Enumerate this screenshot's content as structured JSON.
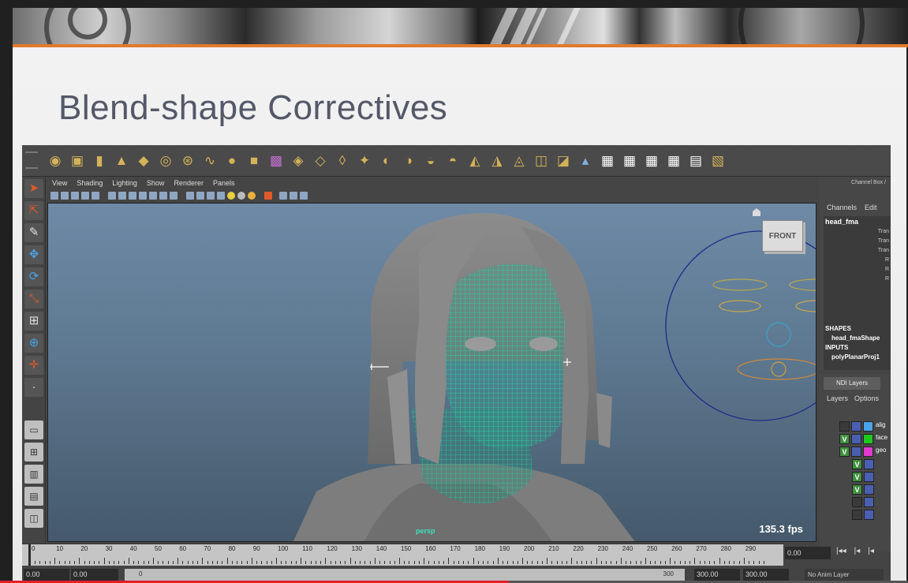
{
  "slide": {
    "title": "Blend-shape Correctives"
  },
  "maya": {
    "panel_menu": [
      "View",
      "Shading",
      "Lighting",
      "Show",
      "Renderer",
      "Panels"
    ],
    "viewcube_label": "FRONT",
    "camera": "persp",
    "fps": "135.3 fps",
    "channel_box": {
      "header": "Channel Box /",
      "menu": [
        "Channels",
        "Edit"
      ],
      "object": "head_fma",
      "attributes": [
        "Tran",
        "Tran",
        "Tran",
        "R",
        "R",
        "R"
      ],
      "shapes_header": "SHAPES",
      "shape_item": "head_fmaShape",
      "inputs_header": "INPUTS",
      "input_item": "polyPlanarProj1"
    },
    "layer_editor": {
      "tab": "NDI Layers",
      "menu": [
        "Layers",
        "Options"
      ],
      "layers": [
        {
          "visible": "",
          "color": "#4aa3e8",
          "name": "alig"
        },
        {
          "visible": "V",
          "color": "#1ec81e",
          "name": "face"
        },
        {
          "visible": "V",
          "color": "#e03ad0",
          "name": "geo"
        },
        {
          "visible": "V",
          "color": "#4a5fb0",
          "name": ""
        },
        {
          "visible": "V",
          "color": "#4a5fb0",
          "name": ""
        },
        {
          "visible": "V",
          "color": "#4a5fb0",
          "name": ""
        },
        {
          "visible": "",
          "color": "#4a5fb0",
          "name": ""
        },
        {
          "visible": "",
          "color": "#1e4fc8",
          "name": ""
        }
      ]
    },
    "timeline": {
      "ticks": [
        "0",
        "10",
        "20",
        "30",
        "40",
        "50",
        "60",
        "70",
        "80",
        "90",
        "100",
        "110",
        "120",
        "130",
        "140",
        "150",
        "160",
        "170",
        "180",
        "190",
        "200",
        "210",
        "220",
        "230",
        "240",
        "250",
        "260",
        "270",
        "280",
        "290"
      ],
      "current_frame": "0.00"
    },
    "range": {
      "start": "0.00",
      "inner_start": "0.00",
      "slider_start": "0",
      "slider_end": "300",
      "end_a": "300.00",
      "end_b": "300.00",
      "anim_layer": "No Anim Layer"
    }
  },
  "video_progress": 0.56
}
